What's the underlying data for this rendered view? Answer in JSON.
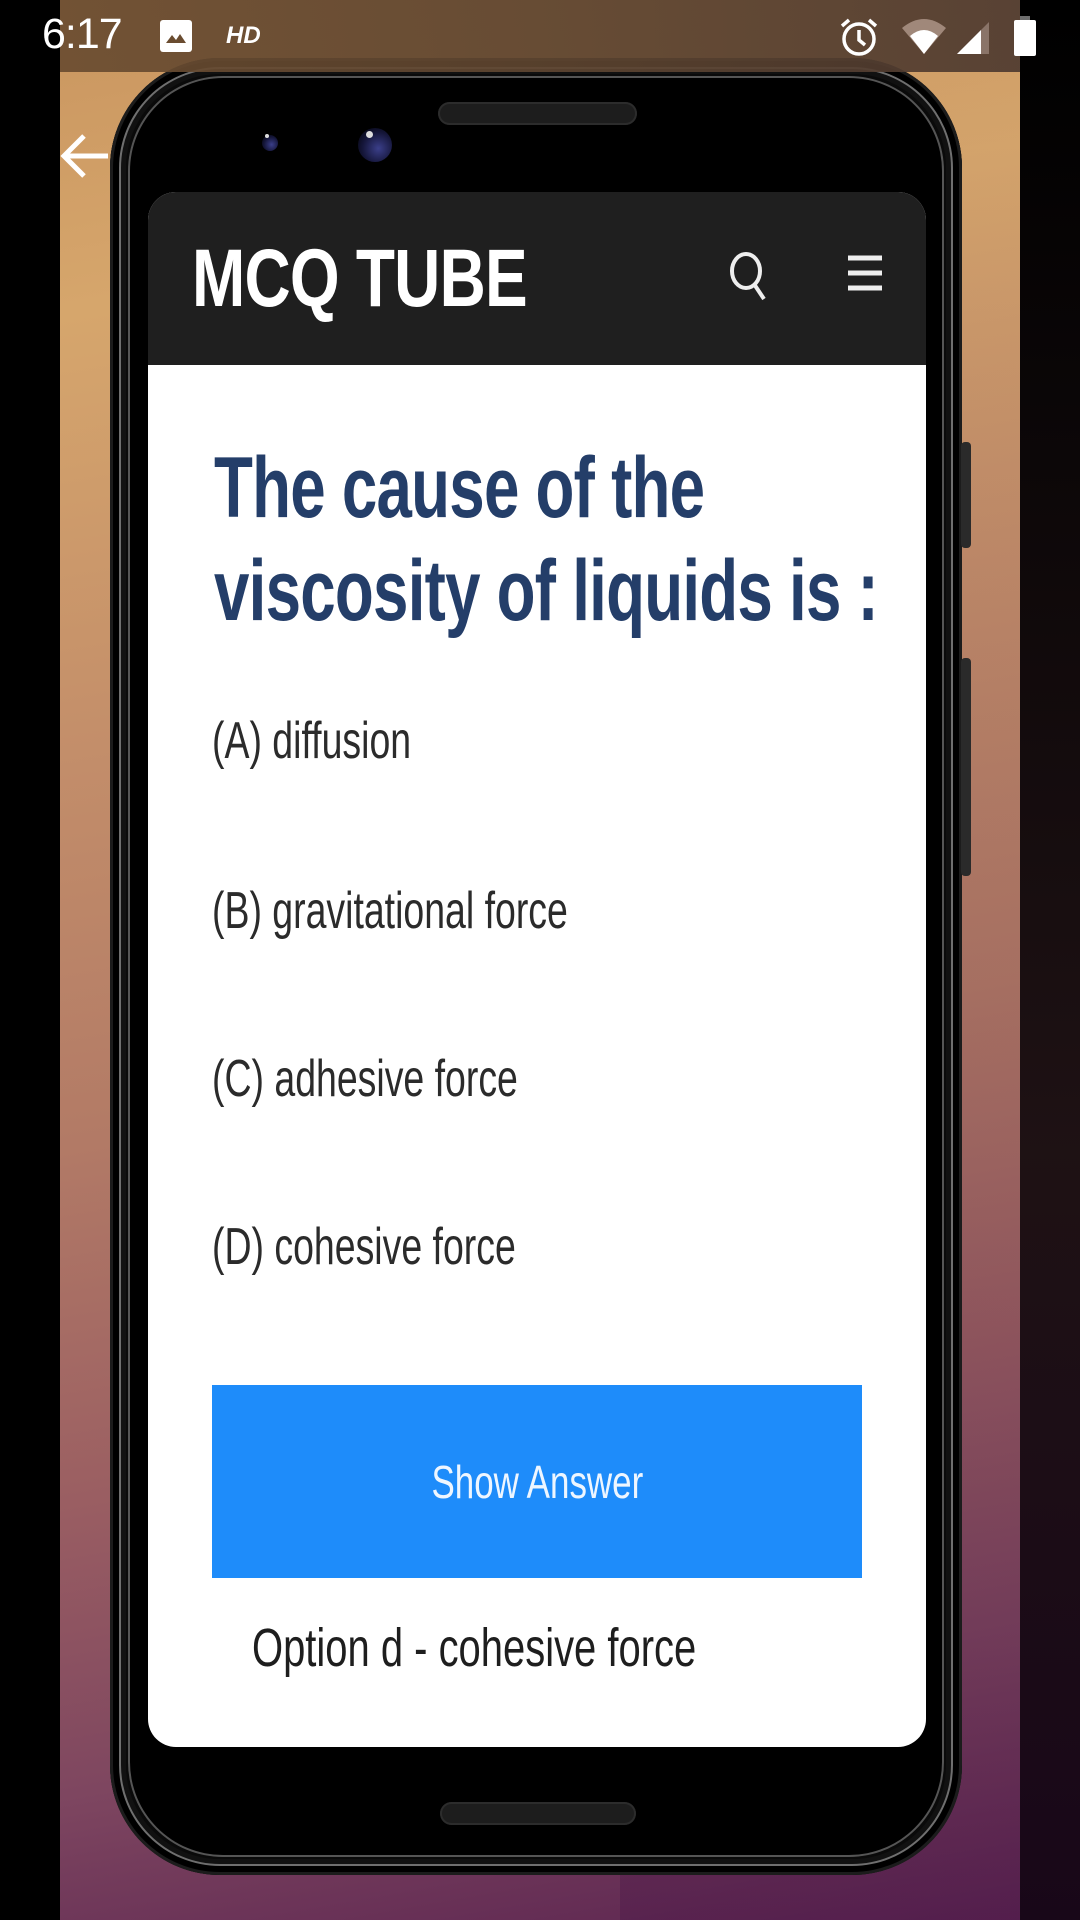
{
  "status_bar": {
    "time": "6:17",
    "quality_badge": "HD",
    "icons": [
      "image-notification-icon",
      "alarm-icon",
      "wifi-icon",
      "cellular-signal-icon",
      "battery-icon"
    ]
  },
  "navigation": {
    "back_icon": "arrow-left-icon"
  },
  "app": {
    "title": "MCQ TUBE",
    "search_icon": "search-icon",
    "menu_icon": "hamburger-menu-icon"
  },
  "question": {
    "text": "The cause of the viscosity of liquids is :",
    "options": [
      {
        "label": "(A) diffusion"
      },
      {
        "label": "(B) gravitational force"
      },
      {
        "label": "(C) adhesive force"
      },
      {
        "label": "(D) cohesive force"
      }
    ],
    "show_answer_label": "Show Answer",
    "answer_text": "Option d - cohesive force"
  },
  "colors": {
    "header_bg": "#1f1f1f",
    "question_text": "#243e69",
    "button_bg": "#1e8cfa",
    "option_text": "#2b2b2b"
  }
}
